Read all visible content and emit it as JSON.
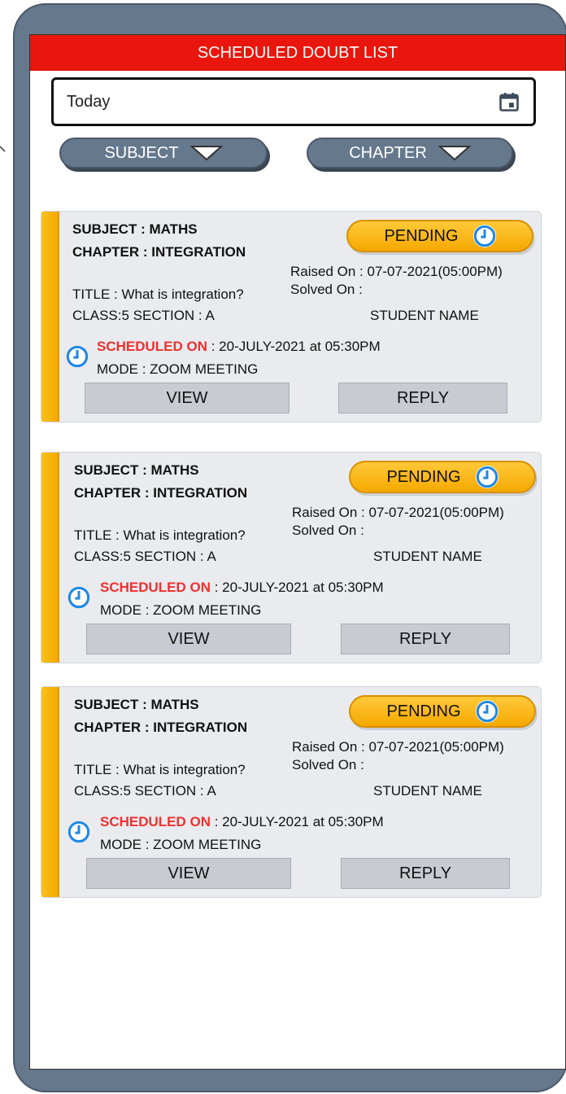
{
  "header": {
    "title": "SCHEDULED DOUBT LIST"
  },
  "date_filter": {
    "value": "Today",
    "icon": "calendar-icon"
  },
  "filters": {
    "subject_label": "SUBJECT",
    "chapter_label": "CHAPTER",
    "icon": "triangle-down-icon"
  },
  "cards": [
    {
      "subject": "SUBJECT :  MATHS",
      "chapter": "CHAPTER : INTEGRATION",
      "status": "PENDING",
      "raised": "Raised  On :  07-07-2021(05:00PM)",
      "solved": "Solved  On :",
      "title": "TITLE : What is integration?",
      "class_section": "CLASS:5   SECTION : A",
      "student": "STUDENT NAME",
      "scheduled_label": "SCHEDULED ON",
      "scheduled_value": " : 20-JULY-2021 at 05:30PM",
      "mode": "MODE : ZOOM MEETING",
      "view_label": "VIEW",
      "reply_label": "REPLY"
    },
    {
      "subject": "SUBJECT :  MATHS",
      "chapter": "CHAPTER : INTEGRATION",
      "status": "PENDING",
      "raised": "Raised  On :  07-07-2021(05:00PM)",
      "solved": "Solved  On :",
      "title": "TITLE : What is integration?",
      "class_section": "CLASS:5   SECTION : A",
      "student": "STUDENT NAME",
      "scheduled_label": "SCHEDULED ON",
      "scheduled_value": " : 20-JULY-2021 at 05:30PM",
      "mode": "MODE : ZOOM MEETING",
      "view_label": "VIEW",
      "reply_label": "REPLY"
    },
    {
      "subject": "SUBJECT :  MATHS",
      "chapter": "CHAPTER : INTEGRATION",
      "status": "PENDING",
      "raised": "Raised  On :  07-07-2021(05:00PM)",
      "solved": "Solved  On :",
      "title": "TITLE : What is integration?",
      "class_section": "CLASS:5   SECTION : A",
      "student": "STUDENT NAME",
      "scheduled_label": "SCHEDULED ON",
      "scheduled_value": " : 20-JULY-2021 at 05:30PM",
      "mode": "MODE : ZOOM MEETING",
      "view_label": "VIEW",
      "reply_label": "REPLY"
    }
  ],
  "colors": {
    "header": "#e8160c",
    "accent": "#f5a800",
    "frame": "#66788c",
    "clock": "#1e88e5",
    "scheduled": "#ee3030"
  }
}
